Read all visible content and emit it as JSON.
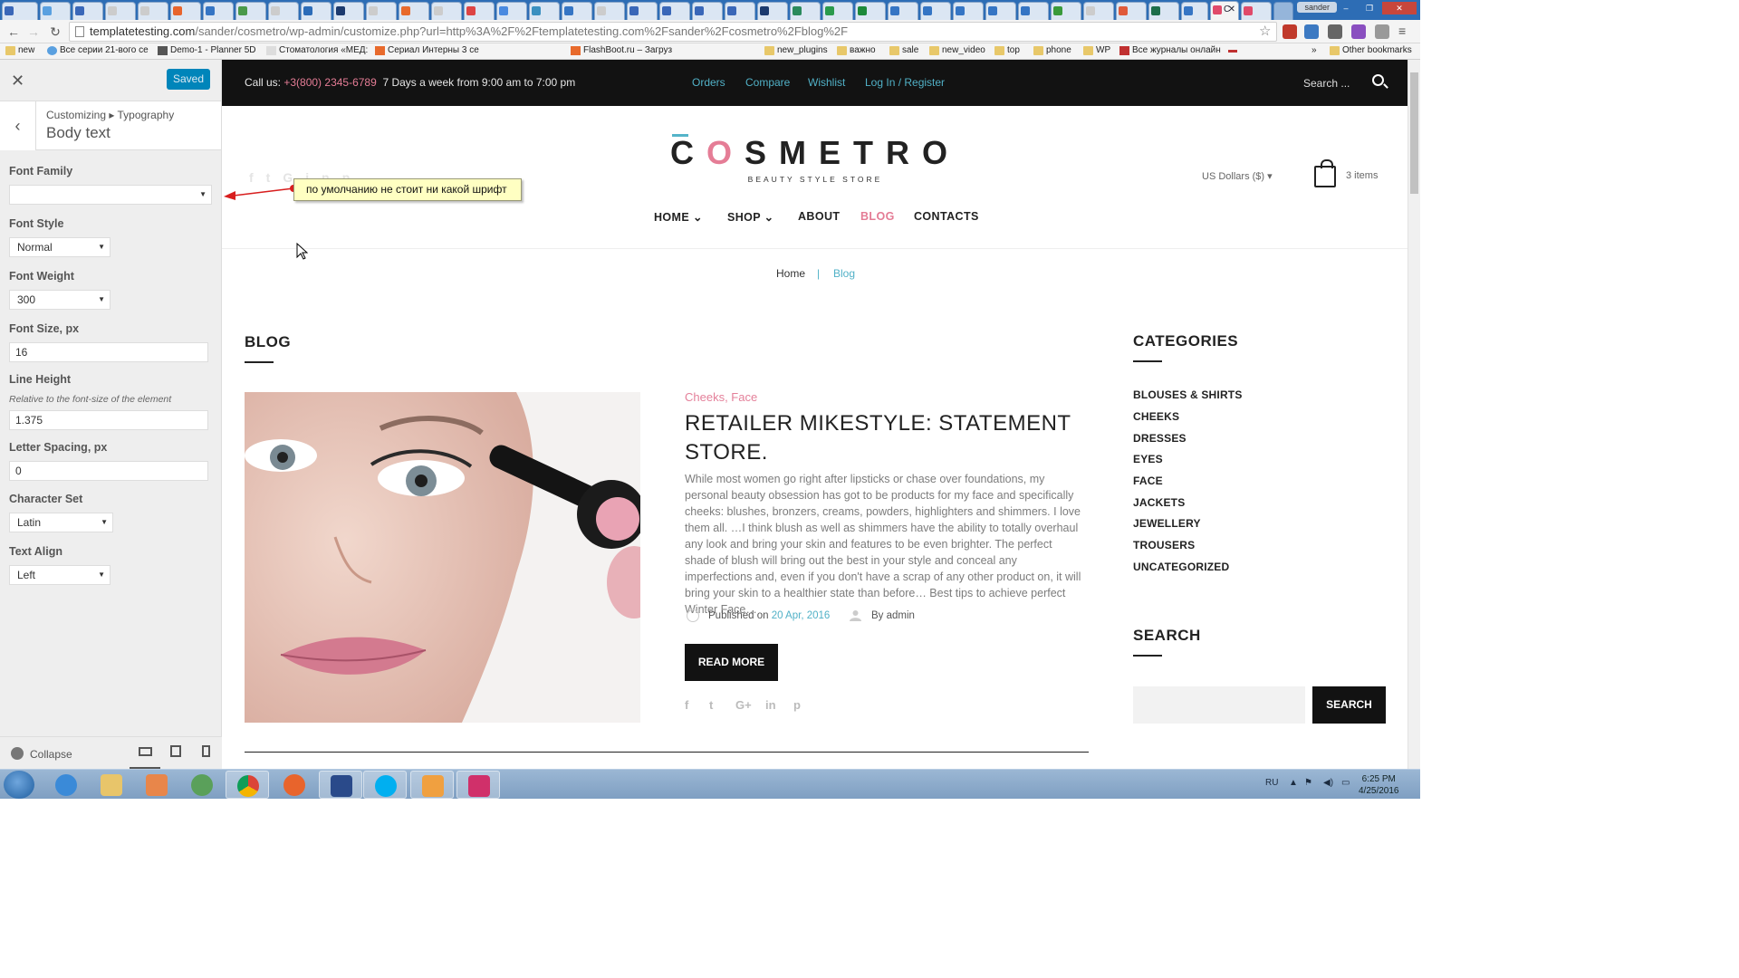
{
  "browser": {
    "tab_count_label": "",
    "active_tab_label": "C",
    "username": "sander",
    "url_host": "templatetesting.com",
    "url_rest": "/sander/cosmetro/wp-admin/customize.php?url=http%3A%2F%2Ftemplatetesting.com%2Fsander%2Fcosmetro%2Fblog%2F",
    "bookmarks": [
      {
        "label": "new",
        "folder": true
      },
      {
        "label": "Все серии 21-вого се",
        "folder": false
      },
      {
        "label": "Demo-1 - Planner 5D",
        "folder": false
      },
      {
        "label": "Стоматология «МЕД:",
        "folder": false
      },
      {
        "label": "Сериал Интерны 3 се",
        "folder": false
      },
      {
        "label": "FlashBoot.ru – Загруз",
        "folder": false
      },
      {
        "label": "new_plugins",
        "folder": true
      },
      {
        "label": "важно",
        "folder": true
      },
      {
        "label": "sale",
        "folder": true
      },
      {
        "label": "new_video",
        "folder": true
      },
      {
        "label": "top",
        "folder": true
      },
      {
        "label": "phone",
        "folder": true
      },
      {
        "label": "WP",
        "folder": true
      },
      {
        "label": "Все журналы онлайн",
        "folder": false
      }
    ],
    "other_bookmarks": "Other bookmarks"
  },
  "customizer": {
    "saved_label": "Saved",
    "breadcrumb": "Customizing ▸ Typography",
    "section_title": "Body text",
    "font_family_label": "Font Family",
    "font_family_value": "",
    "font_style_label": "Font Style",
    "font_style_value": "Normal",
    "font_weight_label": "Font Weight",
    "font_weight_value": "300",
    "font_size_label": "Font Size, px",
    "font_size_value": "16",
    "line_height_label": "Line Height",
    "line_height_note": "Relative to the font-size of the element",
    "line_height_value": "1.375",
    "letter_spacing_label": "Letter Spacing, px",
    "letter_spacing_value": "0",
    "charset_label": "Character Set",
    "charset_value": "Latin",
    "text_align_label": "Text Align",
    "text_align_value": "Left",
    "collapse_label": "Collapse"
  },
  "annotation": {
    "text": "по умолчанию не стоит ни какой шрифт"
  },
  "site": {
    "call_prefix": "Call us:",
    "phone": "+3(800) 2345-6789",
    "hours": "7 Days a week from 9:00 am to 7:00 pm",
    "top_links": [
      "Orders",
      "Compare",
      "Wishlist",
      "Log In / Register"
    ],
    "search_placeholder": "Search ...",
    "logo_before_o": "C",
    "logo_o": "O",
    "logo_after_o": "SMETRO",
    "logo_sub": "BEAUTY STYLE STORE",
    "currency": "US Dollars ($) ▾",
    "cart_items": "3 items",
    "menu": [
      "HOME ⌄",
      "SHOP ⌄",
      "ABOUT",
      "BLOG",
      "CONTACTS"
    ],
    "breadcrumb_home": "Home",
    "breadcrumb_sep": "|",
    "breadcrumb_current": "Blog",
    "blog_heading": "BLOG",
    "post_tags": "Cheeks,  Face",
    "post_title": "RETAILER MIKESTYLE: STATEMENT STORE.",
    "post_excerpt": "While most women go right after lipsticks or chase over foundations, my personal beauty obsession has got to be products for my face and specifically cheeks: blushes, bronzers, creams, powders, highlighters and shimmers. I love them all. …I think blush as well as shimmers have the ability to totally overhaul any look and bring your skin and features to be even brighter. The perfect shade of blush will bring out the best in your style and conceal any imperfections and, even if you don't have a scrap of any other product on, it will bring your skin to a healthier state than before… Best tips to achieve perfect Winter Face…",
    "published_prefix": "Published on",
    "published_date": "20 Apr, 2016",
    "author": "By admin",
    "read_more": "READ MORE",
    "categories_heading": "CATEGORIES",
    "categories": [
      "BLOUSES & SHIRTS",
      "CHEEKS",
      "DRESSES",
      "EYES",
      "FACE",
      "JACKETS",
      "JEWELLERY",
      "TROUSERS",
      "UNCATEGORIZED"
    ],
    "search_heading": "SEARCH",
    "search_button": "SEARCH",
    "share_icons": [
      "f",
      "t",
      "G+",
      "in",
      "p"
    ]
  },
  "taskbar": {
    "lang": "RU",
    "time": "6:25 PM",
    "date": "4/25/2016"
  },
  "colors": {
    "accent_pink": "#e47c95",
    "accent_teal": "#51b1c7",
    "wp_blue": "#0085ba",
    "dark": "#121212"
  }
}
